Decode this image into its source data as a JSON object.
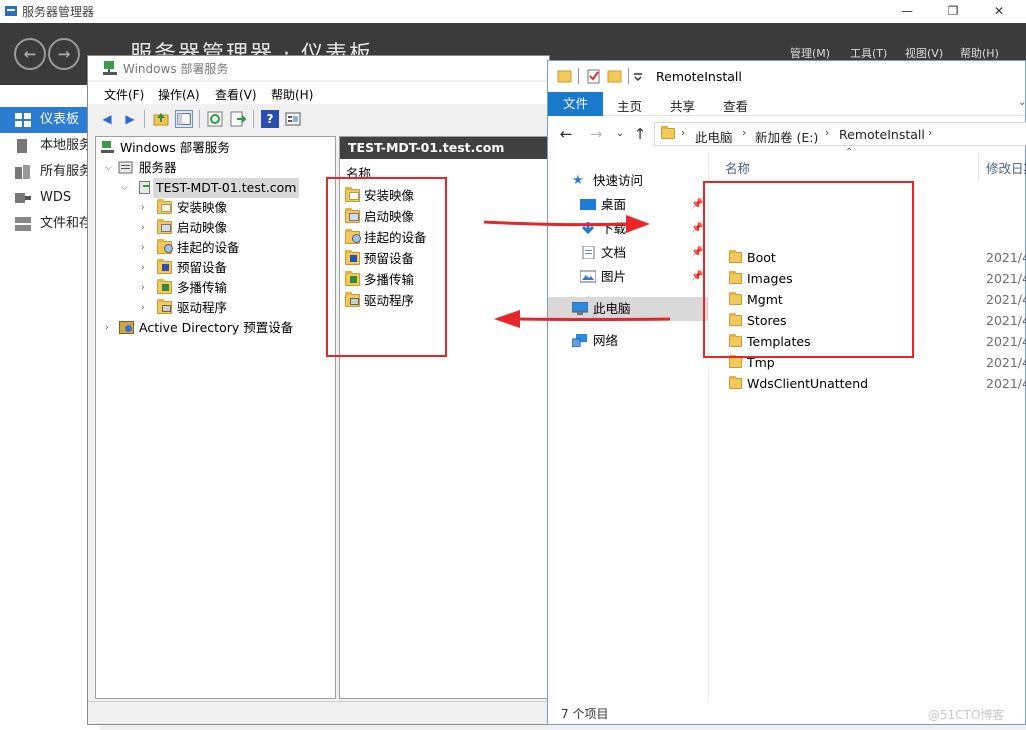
{
  "server_manager": {
    "title": "服务器管理器",
    "heading": "服务器管理器 · 仪表板",
    "controls": {
      "minimize": "—",
      "restore": "❐",
      "close": "✕"
    },
    "nav_back": "←",
    "nav_forward": "→",
    "menus": [
      "管理(M)",
      "工具(T)",
      "视图(V)",
      "帮助(H)"
    ],
    "sidebar": [
      {
        "label": "仪表板",
        "icon": "dashboard-icon",
        "active": true
      },
      {
        "label": "本地服务器",
        "icon": "server-icon",
        "active": false
      },
      {
        "label": "所有服务器",
        "icon": "servers-icon",
        "active": false
      },
      {
        "label": "WDS",
        "icon": "wds-icon",
        "active": false
      },
      {
        "label": "文件和存储服务",
        "icon": "storage-icon",
        "active": false
      }
    ]
  },
  "wds": {
    "title": "Windows 部署服务",
    "menus": [
      "文件(F)",
      "操作(A)",
      "查看(V)",
      "帮助(H)"
    ],
    "tree": {
      "root": "Windows 部署服务",
      "servers": "服务器",
      "server": "TEST-MDT-01.test.com",
      "children": [
        "安装映像",
        "启动映像",
        "挂起的设备",
        "预留设备",
        "多播传输",
        "驱动程序"
      ],
      "active_directory": "Active Directory 预置设备"
    },
    "detail": {
      "header": "TEST-MDT-01.test.com",
      "column_name": "名称",
      "items": [
        "安装映像",
        "启动映像",
        "挂起的设备",
        "预留设备",
        "多播传输",
        "驱动程序"
      ]
    }
  },
  "explorer": {
    "title": "RemoteInstall",
    "tabs": {
      "file": "文件",
      "home": "主页",
      "share": "共享",
      "view": "查看"
    },
    "breadcrumb": [
      "此电脑",
      "新加卷 (E:)",
      "RemoteInstall"
    ],
    "nav": {
      "quick_access": "快速访问",
      "desktop": "桌面",
      "downloads": "下载",
      "documents": "文档",
      "pictures": "图片",
      "this_pc": "此电脑",
      "network": "网络"
    },
    "columns": {
      "name": "名称",
      "modified": "修改日期"
    },
    "folders": [
      {
        "name": "Boot",
        "date": "2021/4"
      },
      {
        "name": "Images",
        "date": "2021/4"
      },
      {
        "name": "Mgmt",
        "date": "2021/4"
      },
      {
        "name": "Stores",
        "date": "2021/4"
      },
      {
        "name": "Templates",
        "date": "2021/4"
      },
      {
        "name": "Tmp",
        "date": "2021/4"
      },
      {
        "name": "WdsClientUnattend",
        "date": "2021/4"
      }
    ],
    "status": "7 个项目"
  },
  "annotations": {
    "color": "#e8262a"
  },
  "watermark": "@51CTO博客"
}
